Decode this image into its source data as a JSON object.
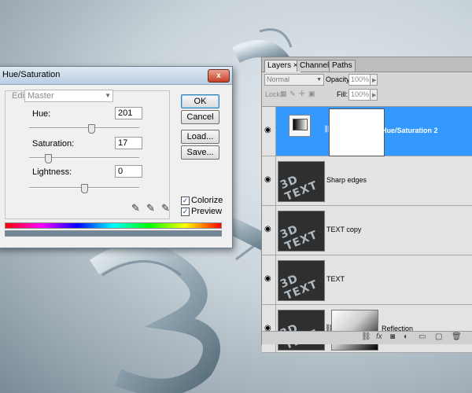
{
  "hue_saturation": {
    "title": "Hue/Saturation",
    "close_label": "x",
    "edit_label": "Edit:",
    "edit_value": "Master",
    "hue_label": "Hue:",
    "hue_value": "201",
    "saturation_label": "Saturation:",
    "saturation_value": "17",
    "lightness_label": "Lightness:",
    "lightness_value": "0",
    "buttons": {
      "ok": "OK",
      "cancel": "Cancel",
      "load": "Load...",
      "save": "Save..."
    },
    "colorize_label": "Colorize",
    "colorize_checked": true,
    "preview_label": "Preview",
    "preview_checked": true
  },
  "layers_panel": {
    "tabs": [
      "Layers ×",
      "Channels",
      "Paths"
    ],
    "blend_mode": "Normal",
    "opacity_label": "Opacity:",
    "opacity_value": "100%",
    "lock_label": "Lock:",
    "fill_label": "Fill:",
    "fill_value": "100%",
    "layers": [
      {
        "name": "Hue/Saturation 2"
      },
      {
        "name": "Sharp edges"
      },
      {
        "name": "TEXT copy"
      },
      {
        "name": "TEXT"
      },
      {
        "name": "Reflection"
      }
    ],
    "thumb_text": "3D TEXT"
  }
}
